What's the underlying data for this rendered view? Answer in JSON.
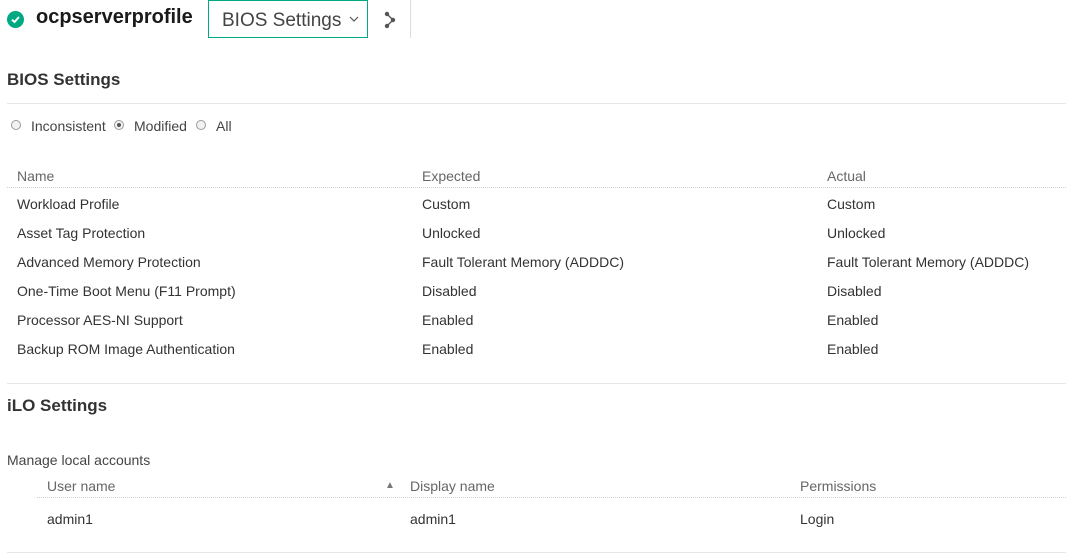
{
  "header": {
    "profile_name": "ocpserverprofile",
    "status": "ok",
    "view_select": "BIOS Settings",
    "accent": "#01a982"
  },
  "bios": {
    "title": "BIOS Settings",
    "filters": [
      {
        "label": "Inconsistent",
        "selected": false
      },
      {
        "label": "Modified",
        "selected": true
      },
      {
        "label": "All",
        "selected": false
      }
    ],
    "columns": [
      "Name",
      "Expected",
      "Actual"
    ],
    "rows": [
      [
        "Workload Profile",
        "Custom",
        "Custom"
      ],
      [
        "Asset Tag Protection",
        "Unlocked",
        "Unlocked"
      ],
      [
        "Advanced Memory Protection",
        "Fault Tolerant Memory (ADDDC)",
        "Fault Tolerant Memory (ADDDC)"
      ],
      [
        "One-Time Boot Menu (F11 Prompt)",
        "Disabled",
        "Disabled"
      ],
      [
        "Processor AES-NI Support",
        "Enabled",
        "Enabled"
      ],
      [
        "Backup ROM Image Authentication",
        "Enabled",
        "Enabled"
      ]
    ]
  },
  "ilo": {
    "title": "iLO Settings",
    "subheading": "Manage local accounts",
    "columns": [
      "User name",
      "Display name",
      "Permissions"
    ],
    "sort_indicator": "▲",
    "rows": [
      [
        "admin1",
        "admin1",
        "Login"
      ]
    ]
  }
}
